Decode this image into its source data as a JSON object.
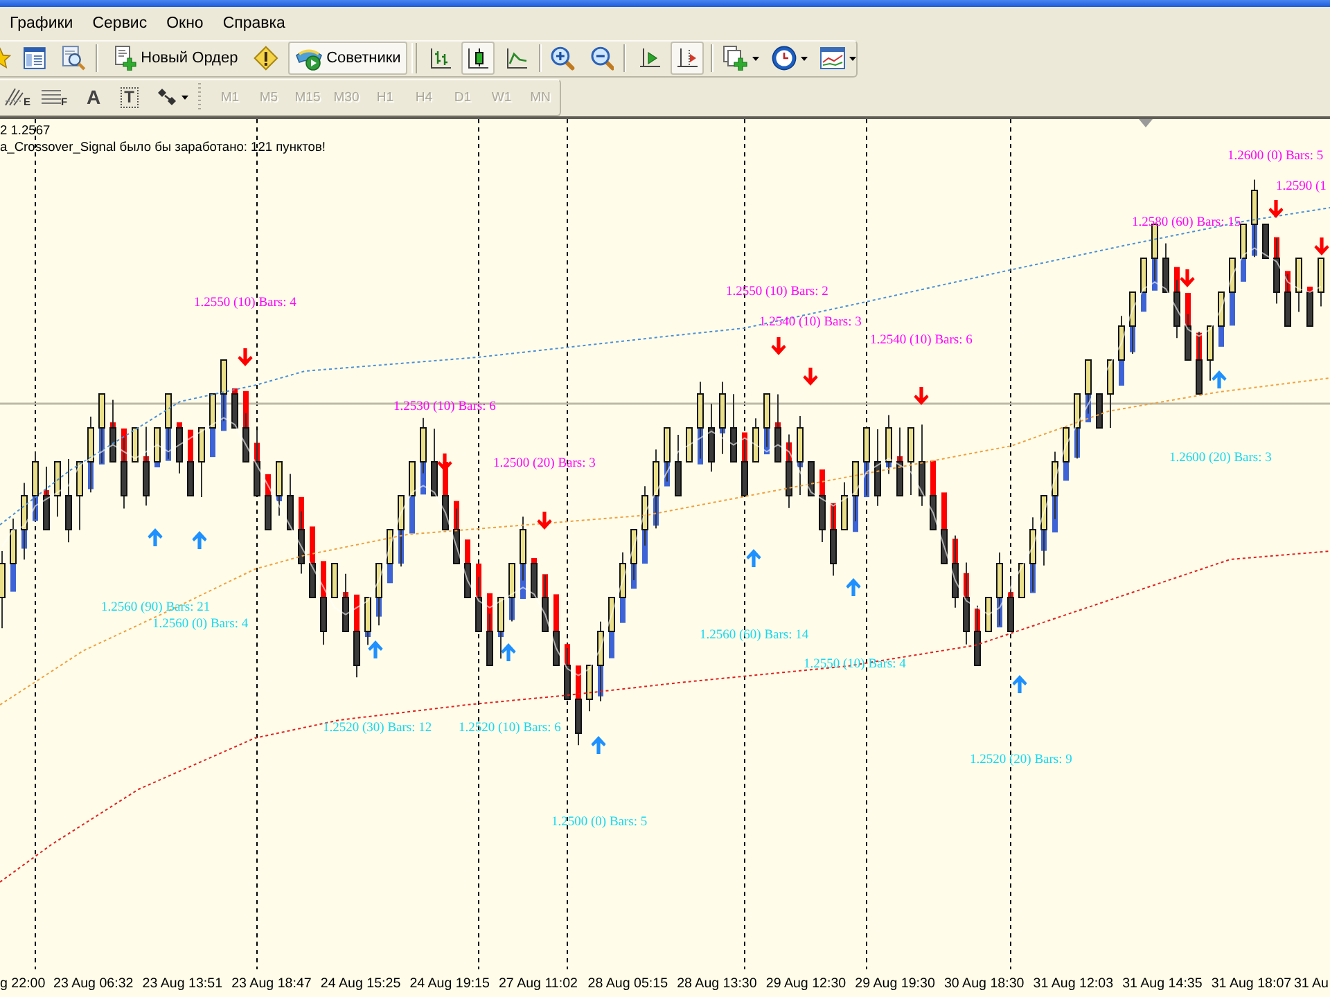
{
  "menu": [
    {
      "label": "Графики"
    },
    {
      "label": "Сервис"
    },
    {
      "label": "Окно"
    },
    {
      "label": "Справка"
    }
  ],
  "toolbar": {
    "new_order": {
      "label": "Новый Ордер"
    },
    "experts": {
      "label": "Советники",
      "on": true
    },
    "chart_types": [
      {
        "kind": "bars",
        "selected": false
      },
      {
        "kind": "candles",
        "selected": true
      },
      {
        "kind": "line",
        "selected": false
      }
    ],
    "scroll_toggles": [
      {
        "kind": "auto-scroll",
        "on": false
      },
      {
        "kind": "chart-shift",
        "on": true
      }
    ]
  },
  "drawing_tools": [
    {
      "kind": "fibo-expansion",
      "glyph": "E"
    },
    {
      "kind": "fibo-lines",
      "glyph": "F"
    },
    {
      "kind": "text",
      "glyph": "A"
    },
    {
      "kind": "text-label",
      "glyph": "T"
    },
    {
      "kind": "arrows"
    }
  ],
  "timeframes": [
    {
      "label": "M1",
      "disabled": true
    },
    {
      "label": "M5",
      "disabled": true
    },
    {
      "label": "M15",
      "disabled": true
    },
    {
      "label": "M30",
      "disabled": true
    },
    {
      "label": "H1",
      "disabled": true
    },
    {
      "label": "H4",
      "disabled": true
    },
    {
      "label": "D1",
      "disabled": true
    },
    {
      "label": "W1",
      "disabled": true
    },
    {
      "label": "MN",
      "disabled": true
    }
  ],
  "chart": {
    "info_lines": [
      "2 1.2567",
      "a_Crossover_Signal было бы заработано: 121 пунктов!"
    ],
    "signal_labels": [
      {
        "text": "1.2600 (0) Bars: 5",
        "color": "#ff00ff"
      },
      {
        "text": "1.2590 (1",
        "color": "#ff00ff"
      },
      {
        "text": "1.2580 (60) Bars: 15",
        "color": "#ff00ff"
      },
      {
        "text": "1.2550 (10) Bars: 2",
        "color": "#ff00ff"
      },
      {
        "text": "1.2550 (10) Bars: 4",
        "color": "#ff00ff"
      },
      {
        "text": "1.2540 (10) Bars: 3",
        "color": "#ff00ff"
      },
      {
        "text": "1.2540 (10) Bars: 6",
        "color": "#ff00ff"
      },
      {
        "text": "1.2530 (10) Bars: 6",
        "color": "#ff00ff"
      },
      {
        "text": "1.2600 (20) Bars: 3",
        "color": "#18d8f0"
      },
      {
        "text": "1.2500 (20) Bars: 3",
        "color": "#ff00ff"
      },
      {
        "text": "1.2560 (90) Bars: 21",
        "color": "#18d8f0"
      },
      {
        "text": "1.2560 (0) Bars: 4",
        "color": "#18d8f0"
      },
      {
        "text": "1.2560 (60) Bars: 14",
        "color": "#18d8f0"
      },
      {
        "text": "1.2550 (10) Bars: 4",
        "color": "#18d8f0"
      },
      {
        "text": "1.2520 (30) Bars: 12",
        "color": "#18d8f0"
      },
      {
        "text": "1.2520 (10) Bars: 6",
        "color": "#18d8f0"
      },
      {
        "text": "1.2520 (20) Bars: 9",
        "color": "#18d8f0"
      },
      {
        "text": "1.2500 (0) Bars: 5",
        "color": "#18d8f0"
      }
    ],
    "time_axis": [
      "g 22:00",
      "23 Aug 06:32",
      "23 Aug 13:51",
      "23 Aug 18:47",
      "24 Aug 15:25",
      "24 Aug 19:15",
      "27 Aug 11:02",
      "28 Aug 05:15",
      "28 Aug 13:30",
      "29 Aug 12:30",
      "29 Aug 19:30",
      "30 Aug 18:30",
      "31 Aug 12:03",
      "31 Aug 14:35",
      "31 Aug 18:07",
      "31 Au"
    ]
  }
}
